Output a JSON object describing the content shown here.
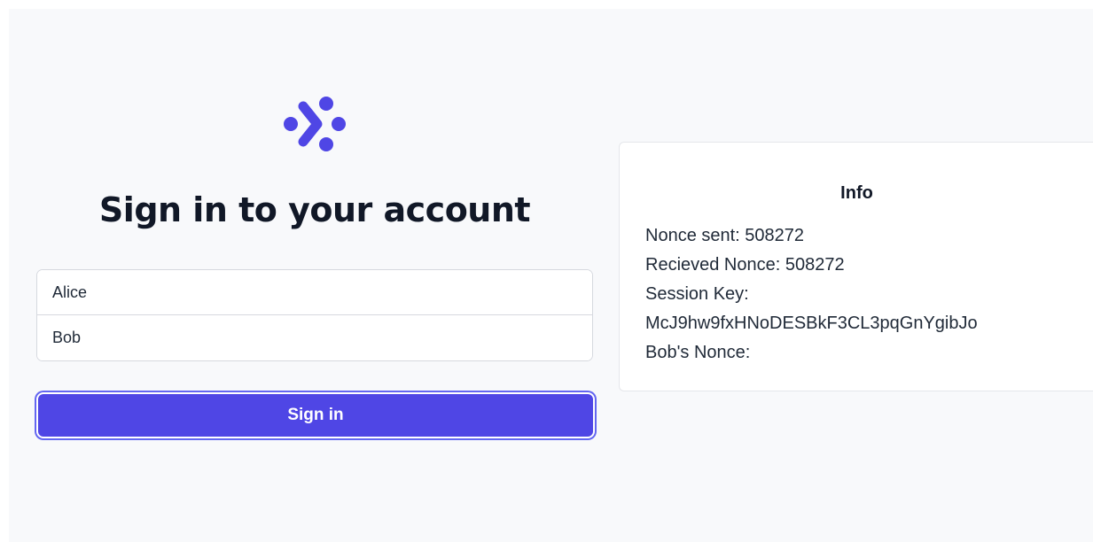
{
  "brand": {
    "logo_icon": "brand-dots-chevron-icon",
    "accent_color": "#4f46e5"
  },
  "login": {
    "heading": "Sign in to your account",
    "username_value": "Alice",
    "target_value": "Bob",
    "submit_label": "Sign in"
  },
  "info": {
    "title": "Info",
    "nonce_sent": "Nonce sent: 508272",
    "received_nonce": "Recieved Nonce: 508272",
    "session_key_label": "Session Key:",
    "session_key_value": "McJ9hw9fxHNoDESBkF3CL3pqGnYgibJo",
    "bob_nonce": "Bob's Nonce:"
  }
}
